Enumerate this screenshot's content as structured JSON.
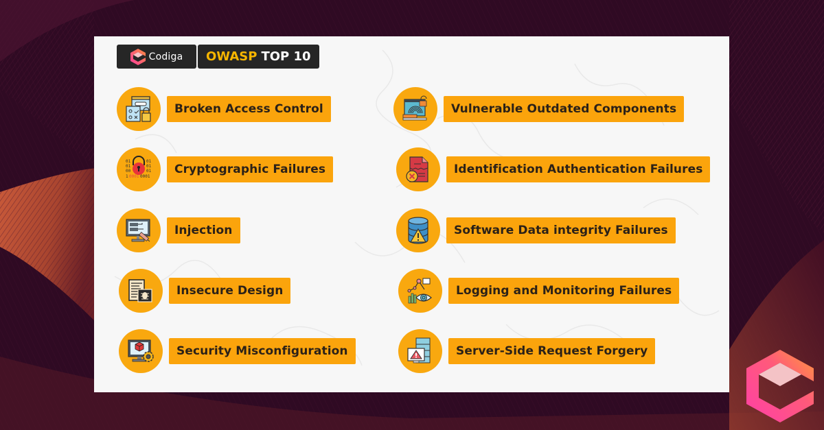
{
  "header": {
    "brand_name": "Codiga",
    "title_accent": "OWASP",
    "title_rest": "TOP 10"
  },
  "colors": {
    "background": "#2f0a23",
    "accent_orange": "#fba40c",
    "icon_circle": "#f9a80f",
    "badge_dark": "#262626",
    "title_yellow": "#f7b500",
    "label_text": "#2b2118",
    "card": "#f7f7f7",
    "logo_gradient_start": "#ff3f9f",
    "logo_gradient_end": "#ff8a3d"
  },
  "items": [
    {
      "label": "Broken Access Control",
      "icon": "access-control-icon"
    },
    {
      "label": "Vulnerable Outdated Components",
      "icon": "fingerprint-laptop-icon"
    },
    {
      "label": "Cryptographic Failures",
      "icon": "binary-lock-icon"
    },
    {
      "label": "Identification Authentication Failures",
      "icon": "broken-document-icon"
    },
    {
      "label": "Injection",
      "icon": "monitor-syringe-icon"
    },
    {
      "label": "Software Data integrity Failures",
      "icon": "database-warning-icon"
    },
    {
      "label": "Insecure Design",
      "icon": "code-bug-icon"
    },
    {
      "label": "Logging and Monitoring Failures",
      "icon": "chart-eye-icon"
    },
    {
      "label": "Security Misconfiguration",
      "icon": "monitor-gear-icon"
    },
    {
      "label": "Server-Side Request Forgery",
      "icon": "server-warning-icon"
    }
  ]
}
